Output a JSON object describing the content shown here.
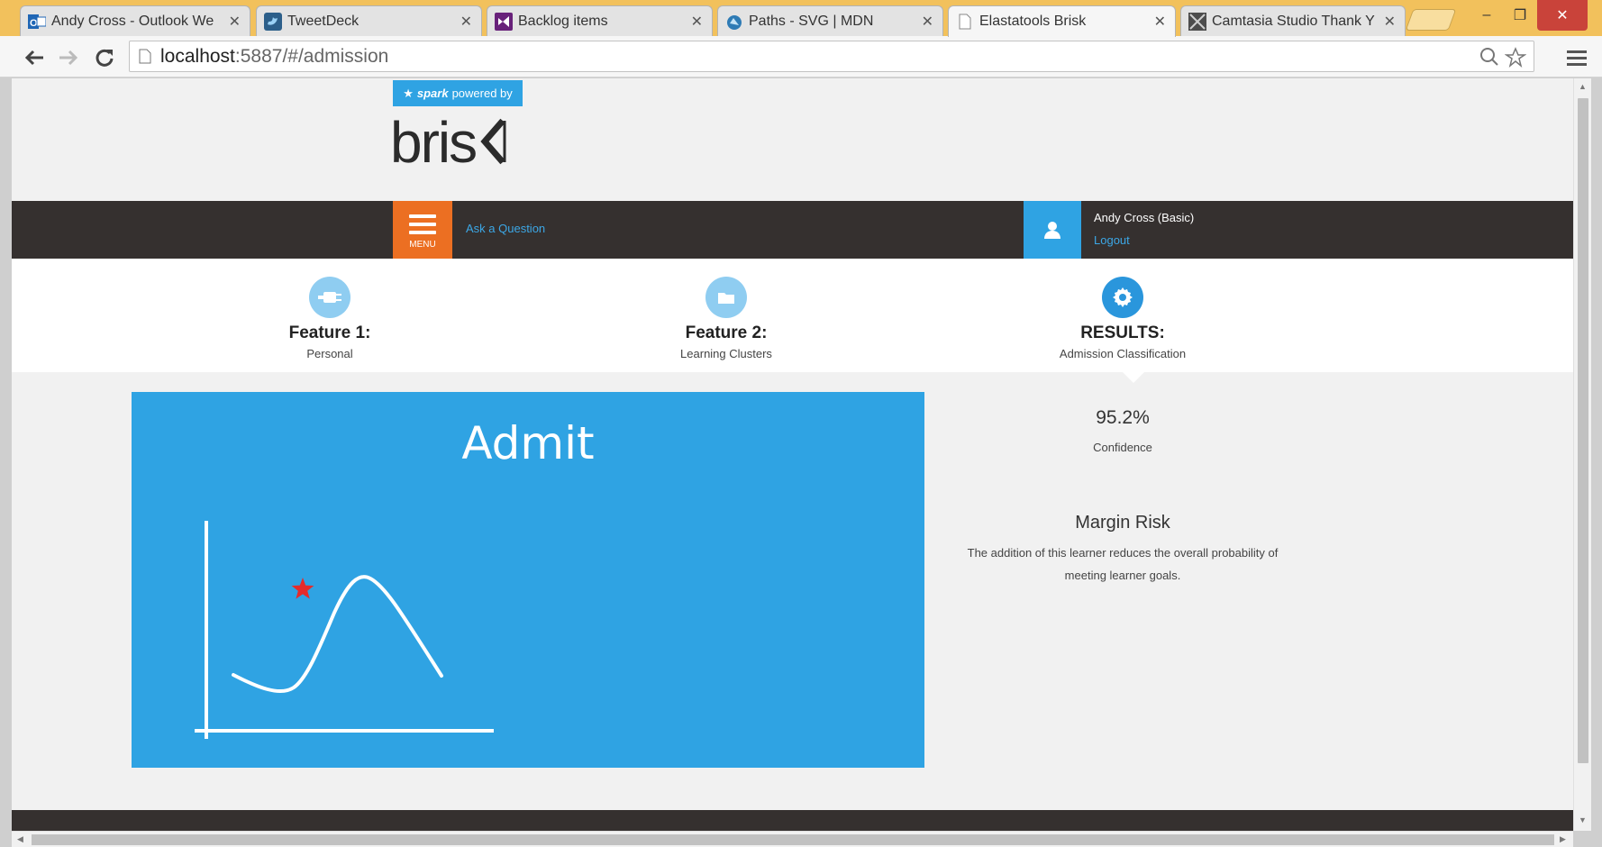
{
  "browser": {
    "tabs": [
      {
        "title": "Andy Cross - Outlook We",
        "icon": "outlook-icon",
        "active": false
      },
      {
        "title": "TweetDeck",
        "icon": "tweetdeck-icon",
        "active": false
      },
      {
        "title": "Backlog items",
        "icon": "visual-studio-icon",
        "active": false
      },
      {
        "title": "Paths - SVG | MDN",
        "icon": "mdn-icon",
        "active": false
      },
      {
        "title": "Elastatools Brisk",
        "icon": "page-icon",
        "active": true
      },
      {
        "title": "Camtasia Studio Thank Y",
        "icon": "camtasia-icon",
        "active": false
      }
    ],
    "url_host": "localhost",
    "url_rest": ":5887/#/admission",
    "window_controls": {
      "minimize": "–",
      "restore": "❐",
      "close": "✕"
    }
  },
  "header": {
    "badge_star": "★",
    "badge_brand": "spark",
    "badge_text": "powered by",
    "logo_text": "bris"
  },
  "nav": {
    "menu_label": "MENU",
    "ask_question": "Ask a Question",
    "user_name": "Andy Cross (Basic)",
    "logout": "Logout"
  },
  "steps": [
    {
      "name": "Feature 1:",
      "subtitle": "Personal",
      "icon": "plug-icon",
      "color": "#8fcdf1"
    },
    {
      "name": "Feature 2:",
      "subtitle": "Learning Clusters",
      "icon": "folder-icon",
      "color": "#8fcdf1"
    },
    {
      "name": "RESULTS:",
      "subtitle": "Admission Classification",
      "icon": "gear-icon",
      "color": "#2a96dc"
    }
  ],
  "result": {
    "title": "Admit",
    "panel_color": "#2fa3e3",
    "marker_color": "#e52b2b"
  },
  "metrics": {
    "confidence_value": "95.2%",
    "confidence_label": "Confidence",
    "risk_title": "Margin Risk",
    "risk_text": "The addition of this learner reduces the overall probability of meeting learner goals."
  }
}
